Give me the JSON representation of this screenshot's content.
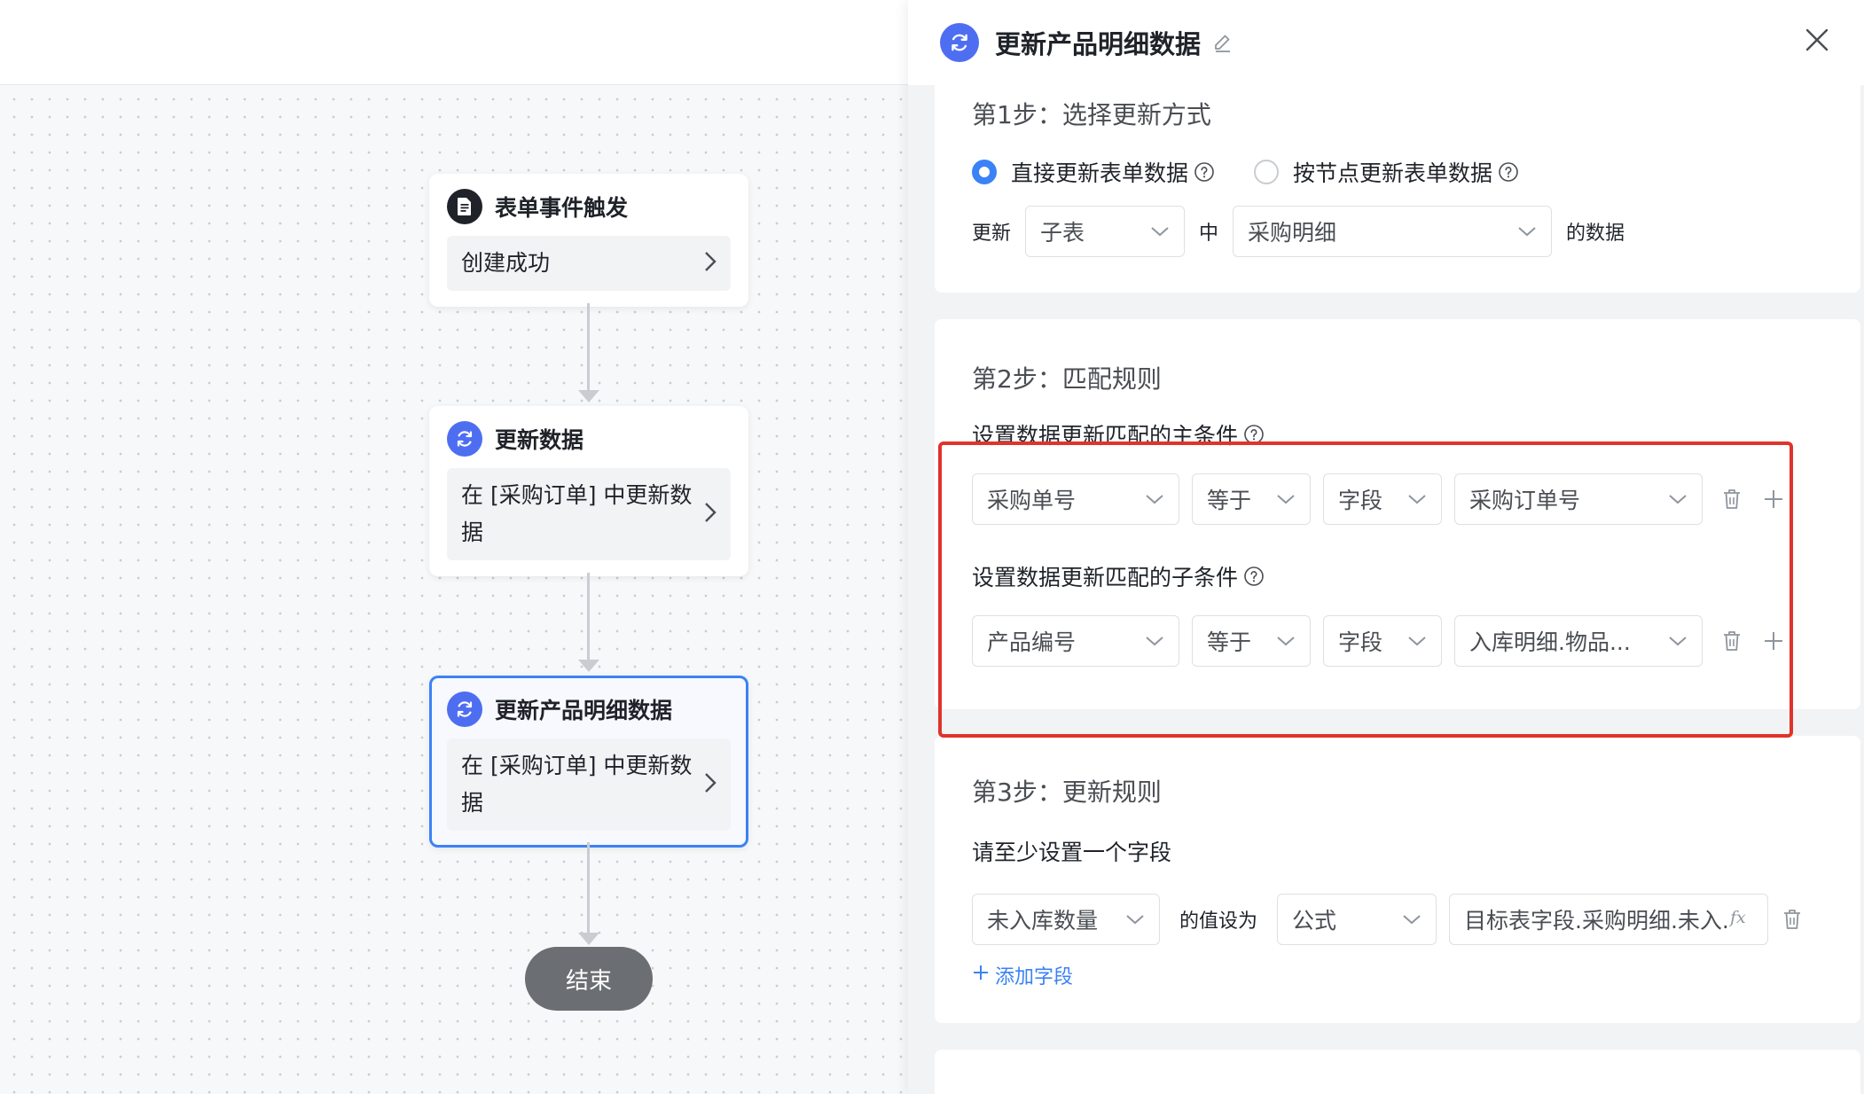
{
  "flow": {
    "nodes": [
      {
        "title": "表单事件触发",
        "body": "创建成功",
        "icon": "document-icon"
      },
      {
        "title": "更新数据",
        "body": "在 [采购订单] 中更新数据",
        "icon": "refresh-icon"
      },
      {
        "title": "更新产品明细数据",
        "body": "在 [采购订单] 中更新数据",
        "icon": "refresh-icon"
      }
    ],
    "end_label": "结束"
  },
  "panel": {
    "title": "更新产品明细数据",
    "step1": {
      "title": "第1步：选择更新方式",
      "radio_direct": "直接更新表单数据",
      "radio_by_node": "按节点更新表单数据",
      "prefix": "更新",
      "target_type": "子表",
      "middle": "中",
      "target_table": "采购明细",
      "suffix": "的数据"
    },
    "step2": {
      "title": "第2步：匹配规则",
      "main_label": "设置数据更新匹配的主条件",
      "main_condition": {
        "field": "采购单号",
        "operator": "等于",
        "type": "字段",
        "value": "采购订单号"
      },
      "sub_label": "设置数据更新匹配的子条件",
      "sub_condition": {
        "field": "产品编号",
        "operator": "等于",
        "type": "字段",
        "value": "入库明细.物品..."
      }
    },
    "step3": {
      "title": "第3步：更新规则",
      "hint": "请至少设置一个字段",
      "rule": {
        "field": "未入库数量",
        "set_to": "的值设为",
        "type": "公式",
        "formula": "目标表字段.采购明细.未入..."
      },
      "add_field": "添加字段"
    }
  },
  "colors": {
    "accent": "#3b82f6",
    "icon_blue": "#4e6ef2",
    "highlight": "#e0332b",
    "end_pill": "#6b6e73"
  }
}
